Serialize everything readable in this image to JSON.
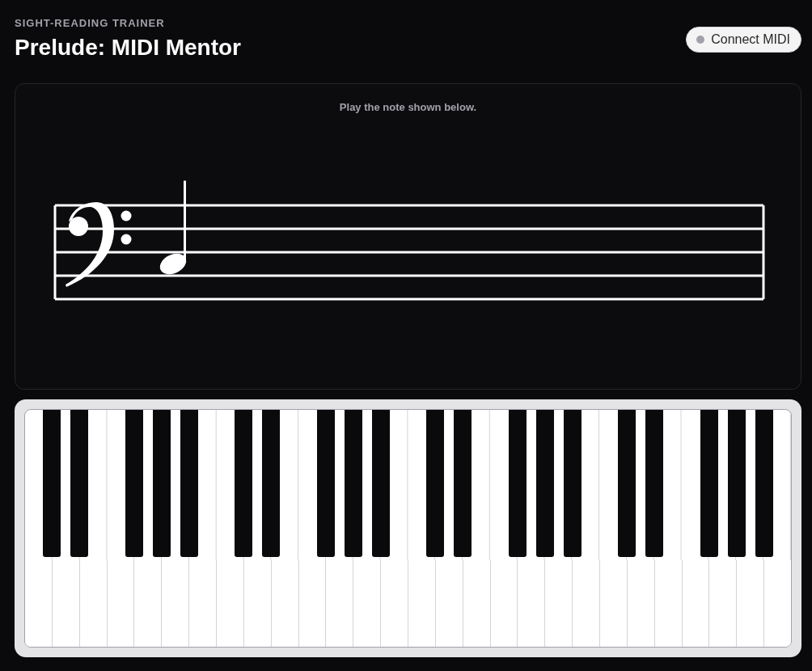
{
  "header": {
    "eyebrow": "SIGHT-READING TRAINER",
    "title": "Prelude: MIDI Mentor"
  },
  "midi_button": {
    "label": "Connect MIDI",
    "connected": false
  },
  "exercise": {
    "prompt": "Play the note shown below."
  }
}
